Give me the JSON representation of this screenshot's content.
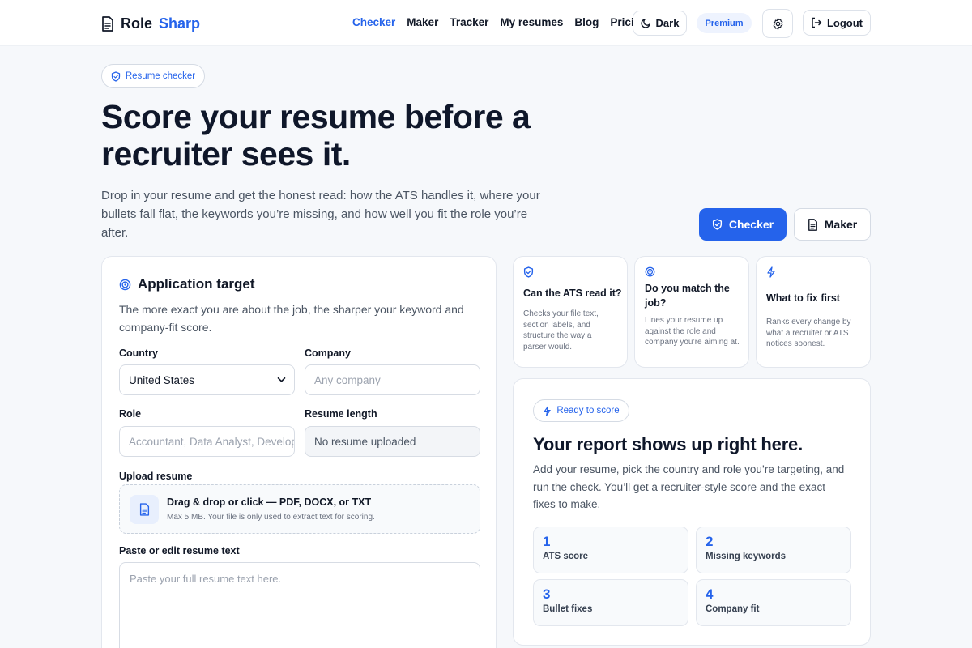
{
  "header": {
    "brand_part1": "Role",
    "brand_part2": "Sharp",
    "nav": [
      "Checker",
      "Maker",
      "Tracker",
      "My resumes",
      "Blog",
      "Pricing"
    ],
    "theme_label": "Dark",
    "premium_label": "Premium",
    "logout_label": "Logout"
  },
  "hero": {
    "badge": "Resume checker",
    "title": "Score your resume before a recruiter sees it.",
    "lead": "Drop in your resume and get the honest read: how the ATS handles it, where your bullets fall flat, the keywords you’re missing, and how well you fit the role you’re after.",
    "checker_button": "Checker",
    "maker_button": "Maker"
  },
  "form": {
    "title": "Application target",
    "subtitle": "The more exact you are about the job, the sharper your keyword and company-fit score.",
    "country_label": "Country",
    "country_value": "United States",
    "company_label": "Company",
    "company_placeholder": "Any company",
    "role_label": "Role",
    "role_placeholder": "Accountant, Data Analyst, Developer",
    "length_label": "Resume length",
    "length_value": "No resume uploaded",
    "upload_label": "Upload resume",
    "upload_title": "Drag & drop or click — PDF, DOCX, or TXT",
    "upload_note": "Max 5 MB. Your file is only used to extract text for scoring.",
    "paste_label": "Paste or edit resume text",
    "paste_placeholder": "Paste your full resume text here."
  },
  "features": [
    {
      "icon": "shield-icon",
      "title": "Can the ATS read it?",
      "text": "Checks your file text, section labels, and structure the way a parser would."
    },
    {
      "icon": "target-icon",
      "title": "Do you match the job?",
      "text": "Lines your resume up against the role and company you’re aiming at."
    },
    {
      "icon": "bolt-icon",
      "title": "What to fix first",
      "text": "Ranks every change by what a recruiter or ATS notices soonest."
    }
  ],
  "report": {
    "badge": "Ready to score",
    "title": "Your report shows up right here.",
    "subtitle": "Add your resume, pick the country and role you’re targeting, and run the check. You’ll get a recruiter-style score and the exact fixes to make.",
    "steps": [
      {
        "num": "1",
        "label": "ATS score"
      },
      {
        "num": "2",
        "label": "Missing keywords"
      },
      {
        "num": "3",
        "label": "Bullet fixes"
      },
      {
        "num": "4",
        "label": "Company fit"
      }
    ]
  },
  "colors": {
    "accent": "#2563eb",
    "text": "#111827",
    "muted": "#4b5563",
    "background": "#f6f8fb"
  }
}
